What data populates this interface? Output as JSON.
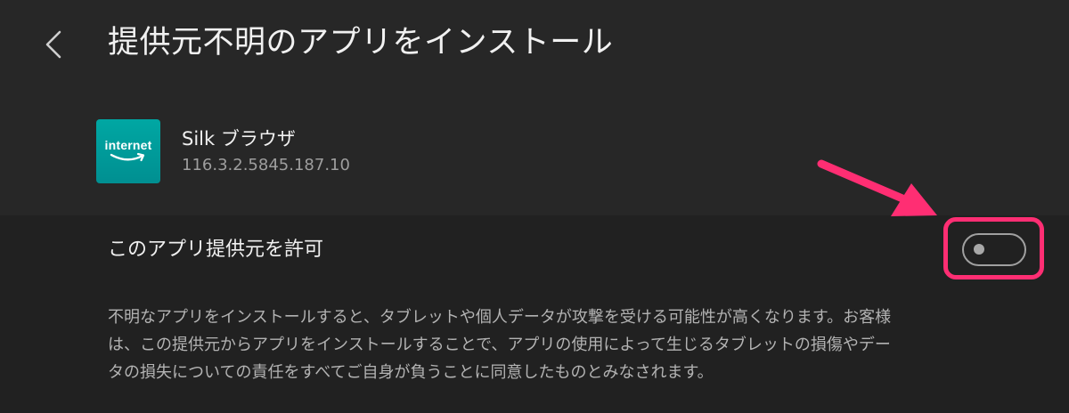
{
  "header": {
    "back_icon": "chevron-left-icon",
    "title": "提供元不明のアプリをインストール"
  },
  "app": {
    "icon_name": "internet-app-icon",
    "icon_text": "internet",
    "name": "Silk ブラウザ",
    "version": "116.3.2.5845.187.10"
  },
  "permission": {
    "label": "このアプリ提供元を許可",
    "enabled": false
  },
  "annotation": {
    "arrow_color": "#ff2e73",
    "highlight_color": "#ff2e73"
  },
  "description": {
    "lines": [
      "不明なアプリをインストールすると、タブレットや個人データが攻撃を受ける可能性が高くなります。お客様",
      "は、この提供元からアプリをインストールすることで、アプリの使用によって生じるタブレットの損傷やデー",
      "タの損失についての責任をすべてご自身が負うことに同意したものとみなされます。"
    ]
  },
  "colors": {
    "background_top": "#272727",
    "background_bottom": "#212121",
    "app_icon": "#00a7a3",
    "toggle_off": "#a0a0a0"
  }
}
